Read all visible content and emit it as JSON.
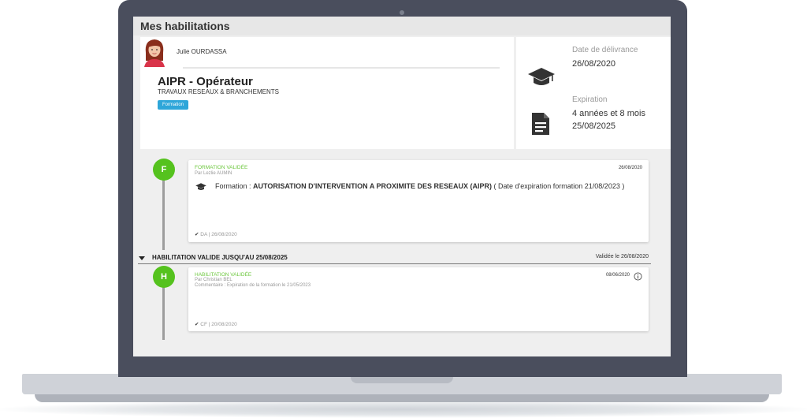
{
  "page": {
    "title": "Mes habilitations"
  },
  "user": {
    "name": "Julie OURDASSA"
  },
  "habilitation": {
    "title": "AIPR - Opérateur",
    "subtitle": "TRAVAUX RESEAUX & BRANCHEMENTS",
    "badge": "Formation"
  },
  "details": {
    "delivery_label": "Date de délivrance",
    "delivery_date": "26/08/2020",
    "expiration_label": "Expiration",
    "expiration_duration": "4 années et 8 mois",
    "expiration_date": "25/08/2025"
  },
  "timeline": {
    "event1": {
      "marker": "F",
      "title": "FORMATION VALIDÉE",
      "by": "Par Lezlie AUMIN",
      "date": "26/08/2020",
      "line_prefix": "Formation : ",
      "line_bold": "AUTORISATION D'INTERVENTION A PROXIMITE DES RESEAUX (AIPR)",
      "line_suffix": " ( Date d'expiration formation 21/08/2023 )",
      "footer": "DA | 26/08/2020"
    },
    "section": {
      "label": "HABILITATION VALIDE JUSQU'AU 25/08/2025",
      "right": "Validée le 26/08/2020"
    },
    "event2": {
      "marker": "H",
      "title": "HABILITATION VALIDÉE",
      "by": "Par Christian BEL",
      "comment": "Commentaire : Expiration de la formation le 21/05/2023",
      "date": "08/06/2020",
      "footer": "CF | 20/08/2020"
    }
  },
  "icons": {
    "avatar": "avatar-woman",
    "delivery": "graduation-cap-icon",
    "expiration": "document-icon",
    "training": "graduation-cap-icon",
    "check": "check-icon",
    "info": "info-icon",
    "collapse": "caret-down-icon"
  },
  "colors": {
    "green": "#55c21e",
    "badge": "#2ea6d9",
    "frame": "#4a4e5d"
  }
}
